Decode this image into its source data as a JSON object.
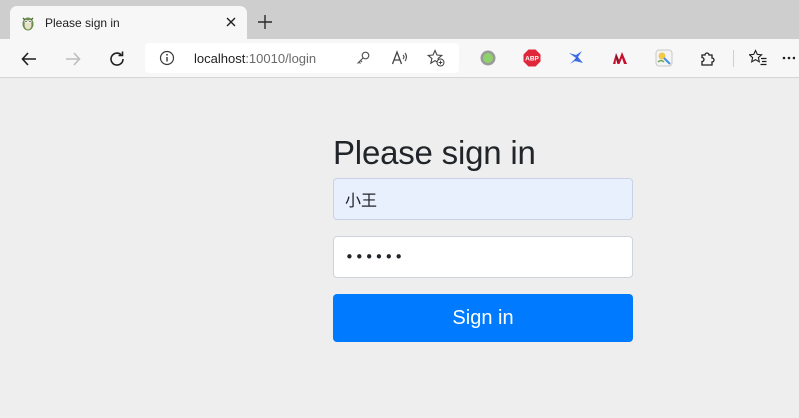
{
  "browser": {
    "tab": {
      "title": "Please sign in",
      "favicon": "owl-favicon-icon",
      "close": "close-icon"
    },
    "new_tab": "plus-icon",
    "nav": {
      "back": "arrow-left-icon",
      "forward": "arrow-right-icon",
      "reload": "reload-icon"
    },
    "address": {
      "host": "localhost",
      "rest": ":10010/login",
      "icons": [
        "info-icon",
        "key-icon",
        "read-aloud-icon",
        "add-favorite-icon"
      ]
    },
    "extensions": [
      "green-circle-extension-icon",
      "adblock-plus-icon",
      "bird-extension-icon",
      "mendeley-icon",
      "translate-extension-icon",
      "puzzle-icon",
      "favorites-icon"
    ]
  },
  "login": {
    "heading": "Please sign in",
    "username": "小王",
    "password_dots": "••••••",
    "submit_label": "Sign in"
  },
  "colors": {
    "accent": "#007bff",
    "autofill_bg": "#e8f0fe",
    "page_bg": "#eeeeee",
    "tabstrip_bg": "#cecece"
  }
}
